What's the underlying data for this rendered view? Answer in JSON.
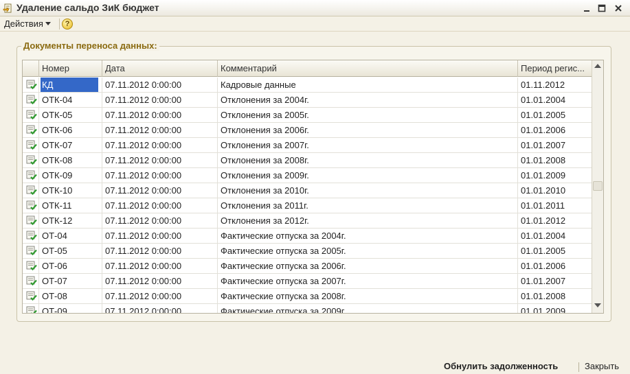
{
  "window": {
    "title": "Удаление сальдо ЗиК бюджет"
  },
  "toolbar": {
    "actions_label": "Действия",
    "help_label": "?"
  },
  "group": {
    "label": "Документы переноса данных:"
  },
  "table": {
    "columns": [
      "",
      "Номер",
      "Дата",
      "Комментарий",
      "Период регис..."
    ],
    "rows": [
      {
        "code": "КД",
        "date": "07.11.2012 0:00:00",
        "comment": "Кадровые данные",
        "period": "01.11.2012"
      },
      {
        "code": "ОТК-04",
        "date": "07.11.2012 0:00:00",
        "comment": "Отклонения за 2004г.",
        "period": "01.01.2004"
      },
      {
        "code": "ОТК-05",
        "date": "07.11.2012 0:00:00",
        "comment": "Отклонения за 2005г.",
        "period": "01.01.2005"
      },
      {
        "code": "ОТК-06",
        "date": "07.11.2012 0:00:00",
        "comment": "Отклонения за 2006г.",
        "period": "01.01.2006"
      },
      {
        "code": "ОТК-07",
        "date": "07.11.2012 0:00:00",
        "comment": "Отклонения за 2007г.",
        "period": "01.01.2007"
      },
      {
        "code": "ОТК-08",
        "date": "07.11.2012 0:00:00",
        "comment": "Отклонения за 2008г.",
        "period": "01.01.2008"
      },
      {
        "code": "ОТК-09",
        "date": "07.11.2012 0:00:00",
        "comment": "Отклонения за 2009г.",
        "period": "01.01.2009"
      },
      {
        "code": "ОТК-10",
        "date": "07.11.2012 0:00:00",
        "comment": "Отклонения за 2010г.",
        "period": "01.01.2010"
      },
      {
        "code": "ОТК-11",
        "date": "07.11.2012 0:00:00",
        "comment": "Отклонения за 2011г.",
        "period": "01.01.2011"
      },
      {
        "code": "ОТК-12",
        "date": "07.11.2012 0:00:00",
        "comment": "Отклонения за 2012г.",
        "period": "01.01.2012"
      },
      {
        "code": "ОТ-04",
        "date": "07.11.2012 0:00:00",
        "comment": "Фактические отпуска за 2004г.",
        "period": "01.01.2004"
      },
      {
        "code": "ОТ-05",
        "date": "07.11.2012 0:00:00",
        "comment": "Фактические отпуска за 2005г.",
        "period": "01.01.2005"
      },
      {
        "code": "ОТ-06",
        "date": "07.11.2012 0:00:00",
        "comment": "Фактические отпуска за 2006г.",
        "period": "01.01.2006"
      },
      {
        "code": "ОТ-07",
        "date": "07.11.2012 0:00:00",
        "comment": "Фактические отпуска за 2007г.",
        "period": "01.01.2007"
      },
      {
        "code": "ОТ-08",
        "date": "07.11.2012 0:00:00",
        "comment": "Фактические отпуска за 2008г.",
        "period": "01.01.2008"
      },
      {
        "code": "ОТ-09",
        "date": "07.11.2012 0:00:00",
        "comment": "Фактические отпуска за 2009г.",
        "period": "01.01.2009"
      }
    ],
    "selected_row": 0,
    "row_icon": "document-posted-icon"
  },
  "footer": {
    "reset_label": "Обнулить задолженность",
    "close_label": "Закрыть"
  },
  "colors": {
    "accent_title": "#8a6a10",
    "selection": "#3468c8",
    "check_green": "#2e9a2e"
  }
}
